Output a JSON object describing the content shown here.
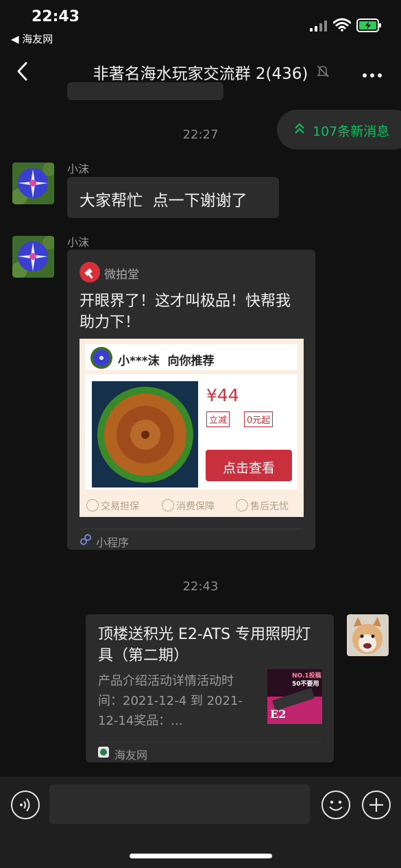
{
  "status_bar": {
    "time": "22:43",
    "back_app_label": "◀ 海友网"
  },
  "nav": {
    "title": "非著名海水玩家交流群 2(436)"
  },
  "new_messages": {
    "label": "107条新消息"
  },
  "timestamps": [
    "22:27",
    "22:43"
  ],
  "messages": [
    {
      "sender": "小沫",
      "text": "大家帮忙  点一下谢谢了"
    },
    {
      "sender": "小沫",
      "card": {
        "source": "微拍堂",
        "title": "开眼界了！这才叫极品！快帮我助力下！",
        "recommender": "小***沫  向你推荐",
        "price": "¥44",
        "tag_discount": "立减",
        "tag_start": "0元起",
        "cta": "点击查看",
        "guarantees": [
          "交易担保",
          "消费保障",
          "售后无忧"
        ],
        "footer": "小程序"
      }
    },
    {
      "sender": "me",
      "link_card": {
        "title": "顶楼送积光 E2-ATS 专用照明灯具（第二期）",
        "desc": "产品介绍活动详情活动时间：2021-12-4 到 2021-12-14奖品：...",
        "thumb_line1": "NO.1投稿",
        "thumb_line2": "50不要用",
        "thumb_brand": "E2",
        "source": "海友网"
      }
    }
  ],
  "colors": {
    "accent_green": "#07c160",
    "red": "#c8303d",
    "bg": "#111111",
    "bubble": "#2c2c2c"
  }
}
